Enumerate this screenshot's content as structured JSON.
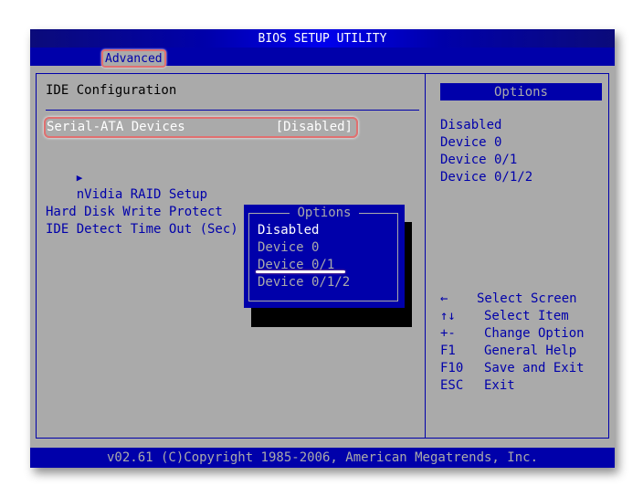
{
  "title": "BIOS SETUP UTILITY",
  "menu": {
    "active_tab": "Advanced"
  },
  "main": {
    "section_title": "IDE Configuration",
    "items": [
      {
        "label": "Serial-ATA Devices",
        "value": "[Disabled]"
      },
      {
        "label": "nVidia RAID Setup",
        "marker": "▶"
      },
      {
        "label": "Hard Disk Write Protect"
      },
      {
        "label": "IDE Detect Time Out (Sec)"
      }
    ]
  },
  "options_panel": {
    "header": "Options",
    "items": [
      "Disabled",
      "Device 0",
      "Device 0/1",
      "Device 0/1/2"
    ]
  },
  "popup": {
    "title": "Options",
    "items": [
      "Disabled",
      "Device 0",
      "Device 0/1",
      "Device 0/1/2"
    ],
    "selected": "Disabled"
  },
  "help": [
    {
      "key": "←",
      "action": "Select Screen"
    },
    {
      "key": "↑↓",
      "action": "Select Item"
    },
    {
      "key": "+-",
      "action": "Change Option"
    },
    {
      "key": "F1",
      "action": "General Help"
    },
    {
      "key": "F10",
      "action": "Save and Exit"
    },
    {
      "key": "ESC",
      "action": "Exit"
    }
  ],
  "footer": "v02.61 (C)Copyright 1985-2006, American Megatrends, Inc.",
  "colors": {
    "bios_blue": "#0000aa",
    "bios_gray": "#aaaaaa",
    "highlight_red": "#e07070"
  }
}
